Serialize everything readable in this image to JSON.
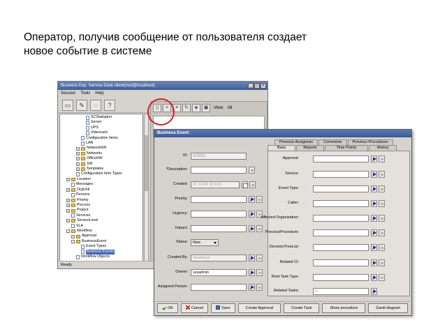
{
  "slide": {
    "title_line1": "Оператор, получив сообщение от пользователя создает",
    "title_line2": "новое событие в системе"
  },
  "app": {
    "window_title": "Business Exp. Service Desk client(root@localhost)",
    "menu": [
      "Session",
      "Tools",
      "Help"
    ],
    "status": "Ready",
    "view_label": "View:",
    "view_value": "All",
    "tree": [
      {
        "label": "SCSIadaptor",
        "indent": 4,
        "icon": "doc",
        "expander": ""
      },
      {
        "label": "Server",
        "indent": 4,
        "icon": "doc",
        "expander": ""
      },
      {
        "label": "UPS",
        "indent": 4,
        "icon": "doc",
        "expander": ""
      },
      {
        "label": "Videocard",
        "indent": 4,
        "icon": "doc",
        "expander": ""
      },
      {
        "label": "Configuration Items",
        "indent": 3,
        "icon": "doc",
        "expander": ""
      },
      {
        "label": "LAN",
        "indent": 3,
        "icon": "doc",
        "expander": ""
      },
      {
        "label": "NetworkHW",
        "indent": 3,
        "icon": "folder",
        "expander": "+"
      },
      {
        "label": "Networks",
        "indent": 3,
        "icon": "folder",
        "expander": "+"
      },
      {
        "label": "OfficeHW",
        "indent": 3,
        "icon": "folder",
        "expander": "+"
      },
      {
        "label": "SW",
        "indent": 3,
        "icon": "folder",
        "expander": "+"
      },
      {
        "label": "Templates",
        "indent": 3,
        "icon": "folder",
        "expander": "+"
      },
      {
        "label": "Configuration Item Types",
        "indent": 2,
        "icon": "doc",
        "expander": ""
      },
      {
        "label": "Location",
        "indent": 1,
        "icon": "folder",
        "expander": "+"
      },
      {
        "label": "Messages",
        "indent": 1,
        "icon": "doc",
        "expander": ""
      },
      {
        "label": "OrgUnit",
        "indent": 1,
        "icon": "folder",
        "expander": "+"
      },
      {
        "label": "Persons",
        "indent": 1,
        "icon": "doc",
        "expander": ""
      },
      {
        "label": "Priority",
        "indent": 1,
        "icon": "folder",
        "expander": "+"
      },
      {
        "label": "Process",
        "indent": 1,
        "icon": "folder",
        "expander": "+"
      },
      {
        "label": "Project",
        "indent": 1,
        "icon": "folder",
        "expander": "+"
      },
      {
        "label": "Services",
        "indent": 1,
        "icon": "doc",
        "expander": ""
      },
      {
        "label": "ServiceLevel",
        "indent": 1,
        "icon": "folder",
        "expander": "+"
      },
      {
        "label": "SLA",
        "indent": 1,
        "icon": "doc",
        "expander": ""
      },
      {
        "label": "Workflow",
        "indent": 1,
        "icon": "folder",
        "expander": "-"
      },
      {
        "label": "Approval",
        "indent": 2,
        "icon": "folder",
        "expander": "+"
      },
      {
        "label": "BusinessEvent",
        "indent": 2,
        "icon": "folder",
        "expander": "-"
      },
      {
        "label": "Event Types",
        "indent": 3,
        "icon": "doc",
        "expander": ""
      },
      {
        "label": "Business Events",
        "indent": 3,
        "icon": "doc",
        "expander": "",
        "selected": true
      },
      {
        "label": "Workflow Objects",
        "indent": 2,
        "icon": "doc",
        "expander": ""
      }
    ]
  },
  "dialog": {
    "title": "Business Event:",
    "left_fields": [
      {
        "label": "ID:",
        "value": "819550",
        "kind": "text",
        "disabled": true,
        "buttons": []
      },
      {
        "label": "*Description:",
        "value": "",
        "kind": "text",
        "disabled": false,
        "buttons": [
          "clear"
        ]
      },
      {
        "label": "Created:",
        "value": "21.10.06 16:10:0",
        "kind": "date",
        "disabled": true,
        "buttons": [
          "cal",
          "clear"
        ]
      },
      {
        "label": "Priority:",
        "value": "",
        "kind": "text",
        "disabled": false,
        "buttons": [
          "arrow",
          "clear"
        ]
      },
      {
        "label": "Urgency:",
        "value": "",
        "kind": "text",
        "disabled": false,
        "buttons": [
          "arrow",
          "clear"
        ]
      },
      {
        "label": "Impact:",
        "value": "",
        "kind": "text",
        "disabled": false,
        "buttons": [
          "arrow",
          "clear"
        ]
      },
      {
        "label": "Status:",
        "value": "New",
        "kind": "select",
        "disabled": false,
        "buttons": []
      },
      {
        "label": "Created By:",
        "value": "Smethson",
        "kind": "text",
        "disabled": true,
        "buttons": [
          "arrow",
          "clear"
        ]
      },
      {
        "label": "Owner:",
        "value": "sysadmin",
        "kind": "text",
        "disabled": false,
        "buttons": [
          "arrow",
          "clear"
        ]
      },
      {
        "label": "Assigned Person:",
        "value": "",
        "kind": "text",
        "disabled": false,
        "buttons": [
          "arrow",
          "clear"
        ]
      }
    ],
    "tabs_back": [
      "Previous Assignees",
      "Comments",
      "Previous Procedures"
    ],
    "tabs_front": [
      "Base",
      "Reports",
      "Time Points",
      "History"
    ],
    "right_fields": [
      {
        "label": "Approval:",
        "value": "",
        "buttons": [
          "arrow",
          "clear"
        ]
      },
      {
        "label": "Service:",
        "value": "",
        "buttons": [
          "arrow",
          "clear"
        ]
      },
      {
        "label": "Event Type:",
        "value": "",
        "buttons": [
          "arrow",
          "clear"
        ]
      },
      {
        "label": "Caller:",
        "value": "",
        "buttons": [
          "arrow",
          "clear"
        ]
      },
      {
        "label": "Affected Organization:",
        "value": "",
        "buttons": [
          "arrow",
          "clear"
        ]
      },
      {
        "label": "Process/Procedure:",
        "value": "",
        "buttons": [
          "arrow",
          "clear"
        ]
      },
      {
        "label": "DecisionTreeList:",
        "value": "",
        "buttons": [
          "arrow",
          "clear"
        ]
      },
      {
        "label": "Related CI:",
        "value": "",
        "buttons": [
          "arrow",
          "clear"
        ]
      },
      {
        "label": "Root Task Type:",
        "value": "",
        "buttons": [
          "arrow",
          "clear"
        ]
      },
      {
        "label": "Related Tasks:",
        "value": "0",
        "buttons": [
          "edit"
        ]
      }
    ],
    "buttons": {
      "ok": "OK",
      "cancel": "Cancel",
      "save": "Save",
      "create_approval": "Create Approval",
      "create_task": "Create Task",
      "show_procedure": "Show procedure",
      "gantt": "Gantt diagram"
    }
  }
}
